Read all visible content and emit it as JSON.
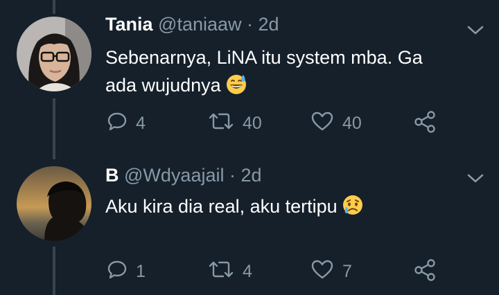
{
  "colors": {
    "background": "#15202b",
    "text": "#ffffff",
    "muted": "#8899a6",
    "thread_line": "#38444d"
  },
  "tweets": [
    {
      "name": "Tania",
      "handle": "@taniaaw",
      "time": " · 2d",
      "text_lines": [
        "Sebenarnya, LiNA itu system mba. Ga",
        "ada wujudnya"
      ],
      "emoji": "grinning-sweat-emoji",
      "replies": "4",
      "retweets": "40",
      "likes": "40"
    },
    {
      "name": "B",
      "handle": "@Wdyaajail",
      "time": " · 2d",
      "text_lines": [
        "Aku kira dia real, aku tertipu"
      ],
      "emoji": "sad-tear-emoji",
      "replies": "1",
      "retweets": "4",
      "likes": "7"
    }
  ],
  "icons": [
    "reply-icon",
    "retweet-icon",
    "like-icon",
    "share-icon",
    "chevron-down-icon"
  ]
}
